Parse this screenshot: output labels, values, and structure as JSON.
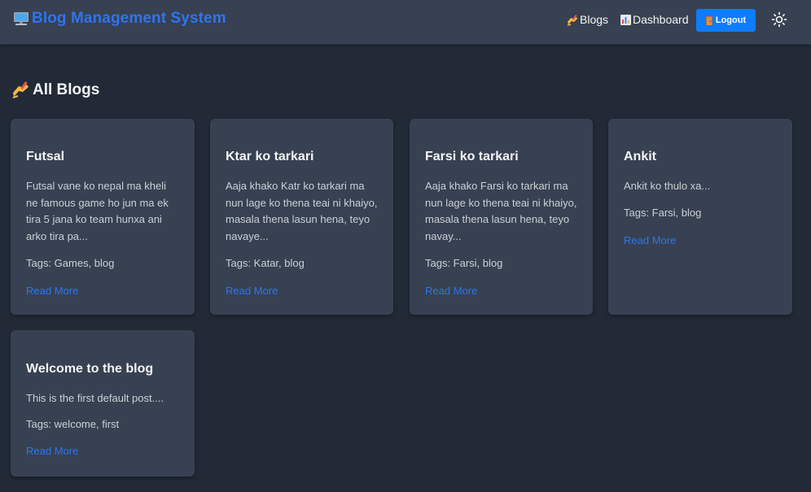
{
  "navbar": {
    "brand_title": "Blog Management System",
    "links": {
      "blogs_label": "Blogs",
      "dashboard_label": "Dashboard"
    },
    "logout_label": "Logout"
  },
  "page": {
    "heading": "All Blogs"
  },
  "posts": [
    {
      "title": "Futsal",
      "excerpt": "Futsal vane ko nepal ma kheli ne famous game ho jun ma ek tira 5 jana ko team hunxa ani arko tira pa...",
      "tags": "Tags: Games, blog",
      "read_more": "Read More"
    },
    {
      "title": "Ktar ko tarkari",
      "excerpt": "Aaja khako Katr ko tarkari ma nun lage ko thena teai ni khaiyo, masala thena lasun hena, teyo navaye...",
      "tags": "Tags: Katar, blog",
      "read_more": "Read More"
    },
    {
      "title": "Farsi ko tarkari",
      "excerpt": "Aaja khako Farsi ko tarkari ma nun lage ko thena teai ni khaiyo, masala thena lasun hena, teyo navay...",
      "tags": "Tags: Farsi, blog",
      "read_more": "Read More"
    },
    {
      "title": "Ankit",
      "excerpt": "Ankit ko thulo xa...",
      "tags": "Tags: Farsi, blog",
      "read_more": "Read More"
    },
    {
      "title": "Welcome to the blog",
      "excerpt": "This is the first default post....",
      "tags": "Tags: welcome, first",
      "read_more": "Read More"
    }
  ],
  "icons": {
    "brand": "computer-icon",
    "blogs": "writing-hand-icon",
    "dashboard": "bar-chart-icon",
    "logout": "door-icon",
    "theme": "sun-icon",
    "heading": "writing-hand-icon"
  },
  "colors": {
    "accent": "#2f74ef",
    "logout_button": "#0d7dff",
    "navbar_bg": "#374151",
    "page_bg": "#222a37",
    "card_bg": "#374151"
  }
}
